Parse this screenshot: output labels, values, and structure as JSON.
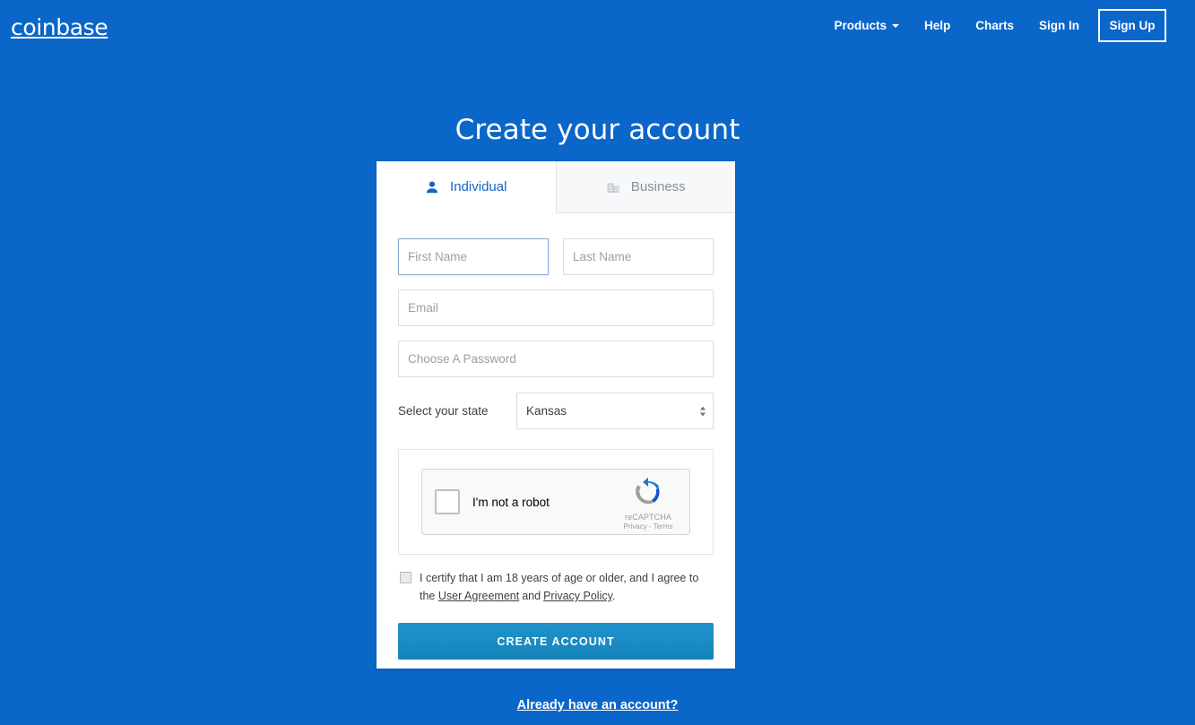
{
  "brand": {
    "name": "coinbase"
  },
  "nav": {
    "links": [
      {
        "label": "Products",
        "has_caret": true,
        "icon": "chevron-down-icon"
      },
      {
        "label": "Help",
        "has_caret": false
      },
      {
        "label": "Charts",
        "has_caret": false
      },
      {
        "label": "Sign In",
        "has_caret": false
      }
    ],
    "signup_label": "Sign Up"
  },
  "page": {
    "title": "Create your account"
  },
  "tabs": [
    {
      "label": "Individual",
      "icon": "person-icon",
      "active": true
    },
    {
      "label": "Business",
      "icon": "building-icon",
      "active": false
    }
  ],
  "form": {
    "first_name": {
      "placeholder": "First Name",
      "value": "",
      "focused": true
    },
    "last_name": {
      "placeholder": "Last Name",
      "value": ""
    },
    "email": {
      "placeholder": "Email",
      "value": ""
    },
    "password": {
      "placeholder": "Choose A Password",
      "value": ""
    },
    "state": {
      "label": "Select your state",
      "selected": "Kansas",
      "icon": "stepper-arrows-icon"
    }
  },
  "captcha": {
    "label": "I'm not a robot",
    "brand": "reCAPTCHA",
    "links": "Privacy - Terms",
    "logo_icon": "recaptcha-logo-icon",
    "checked": false
  },
  "consent": {
    "text_before": "I certify that I am 18 years of age or older, and I agree to the",
    "link_user_agreement": "User Agreement",
    "text_between": "and",
    "link_privacy_policy": "Privacy Policy",
    "text_after": ".",
    "checked": false
  },
  "submit": {
    "label": "CREATE ACCOUNT"
  },
  "footer": {
    "text": "Already have an account?"
  },
  "colors": {
    "brand_blue": "#0a66c9",
    "accent_blue": "#1565c0",
    "button_blue": "#1a8fc7",
    "inactive_gray": "#8a9099"
  }
}
